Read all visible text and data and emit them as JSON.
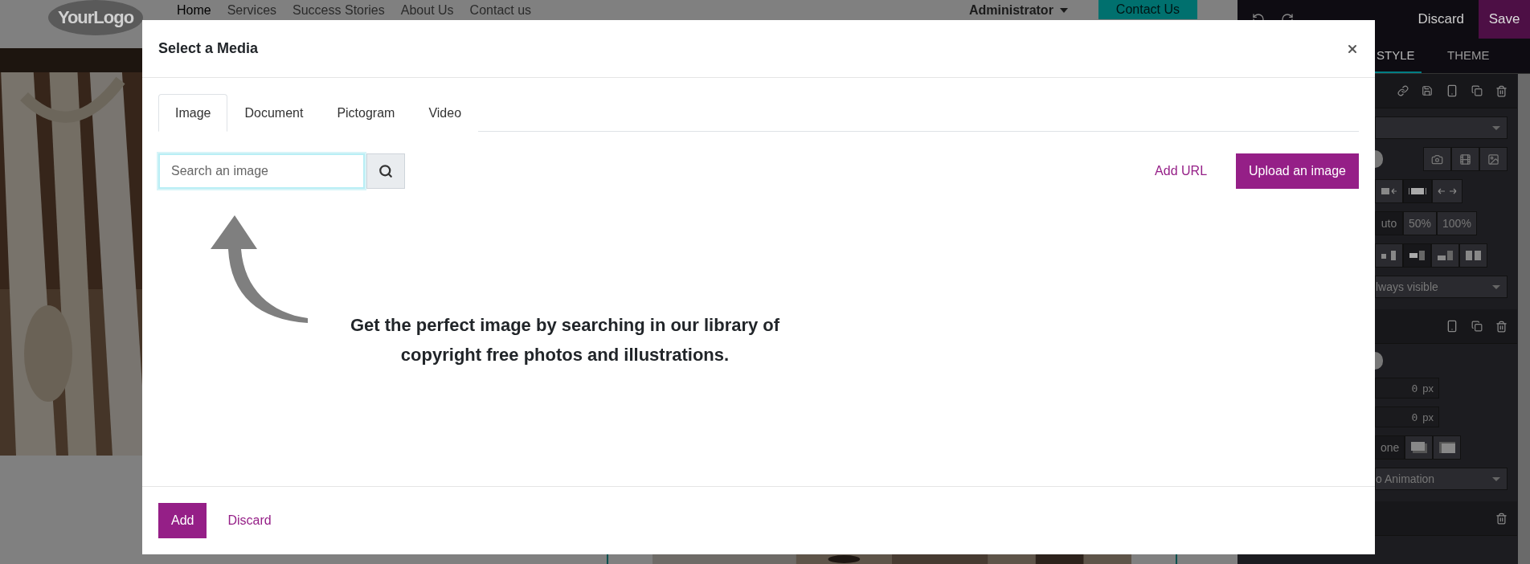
{
  "site": {
    "logo": "YourLogo",
    "nav": [
      {
        "label": "Home",
        "selected": true
      },
      {
        "label": "Services",
        "selected": false
      },
      {
        "label": "Success Stories",
        "selected": false
      },
      {
        "label": "About Us",
        "selected": false
      },
      {
        "label": "Contact us",
        "selected": false
      }
    ],
    "user": "Administrator",
    "cta": "Contact Us"
  },
  "editor": {
    "discard": "Discard",
    "save": "Save",
    "tabs": [
      {
        "label": "STYLE",
        "selected": true
      },
      {
        "label": "THEME",
        "selected": false
      }
    ],
    "toggles": [
      {
        "on": true
      },
      {
        "on": true
      }
    ],
    "width_options": [
      {
        "label": "uto",
        "selected": true
      },
      {
        "label": "50%",
        "selected": false
      },
      {
        "label": "100%",
        "selected": false
      }
    ],
    "visibility": "lways visible",
    "inputs": [
      {
        "value": "0",
        "unit": "px"
      },
      {
        "value": "0",
        "unit": "px"
      }
    ],
    "shadow_options": [
      {
        "kind": "text",
        "label": "one",
        "selected": true
      },
      {
        "kind": "outset",
        "selected": false
      },
      {
        "kind": "inset",
        "selected": false
      }
    ],
    "animation": "o Animation"
  },
  "modal": {
    "title": "Select a Media",
    "tabs": [
      {
        "label": "Image",
        "selected": true
      },
      {
        "label": "Document",
        "selected": false
      },
      {
        "label": "Pictogram",
        "selected": false
      },
      {
        "label": "Video",
        "selected": false
      }
    ],
    "search": {
      "placeholder": "Search an image"
    },
    "add_url": "Add URL",
    "upload": "Upload an image",
    "hint": "Get the perfect image by searching in our library of copyright free photos and illustrations.",
    "footer": {
      "add": "Add",
      "discard": "Discard"
    }
  }
}
